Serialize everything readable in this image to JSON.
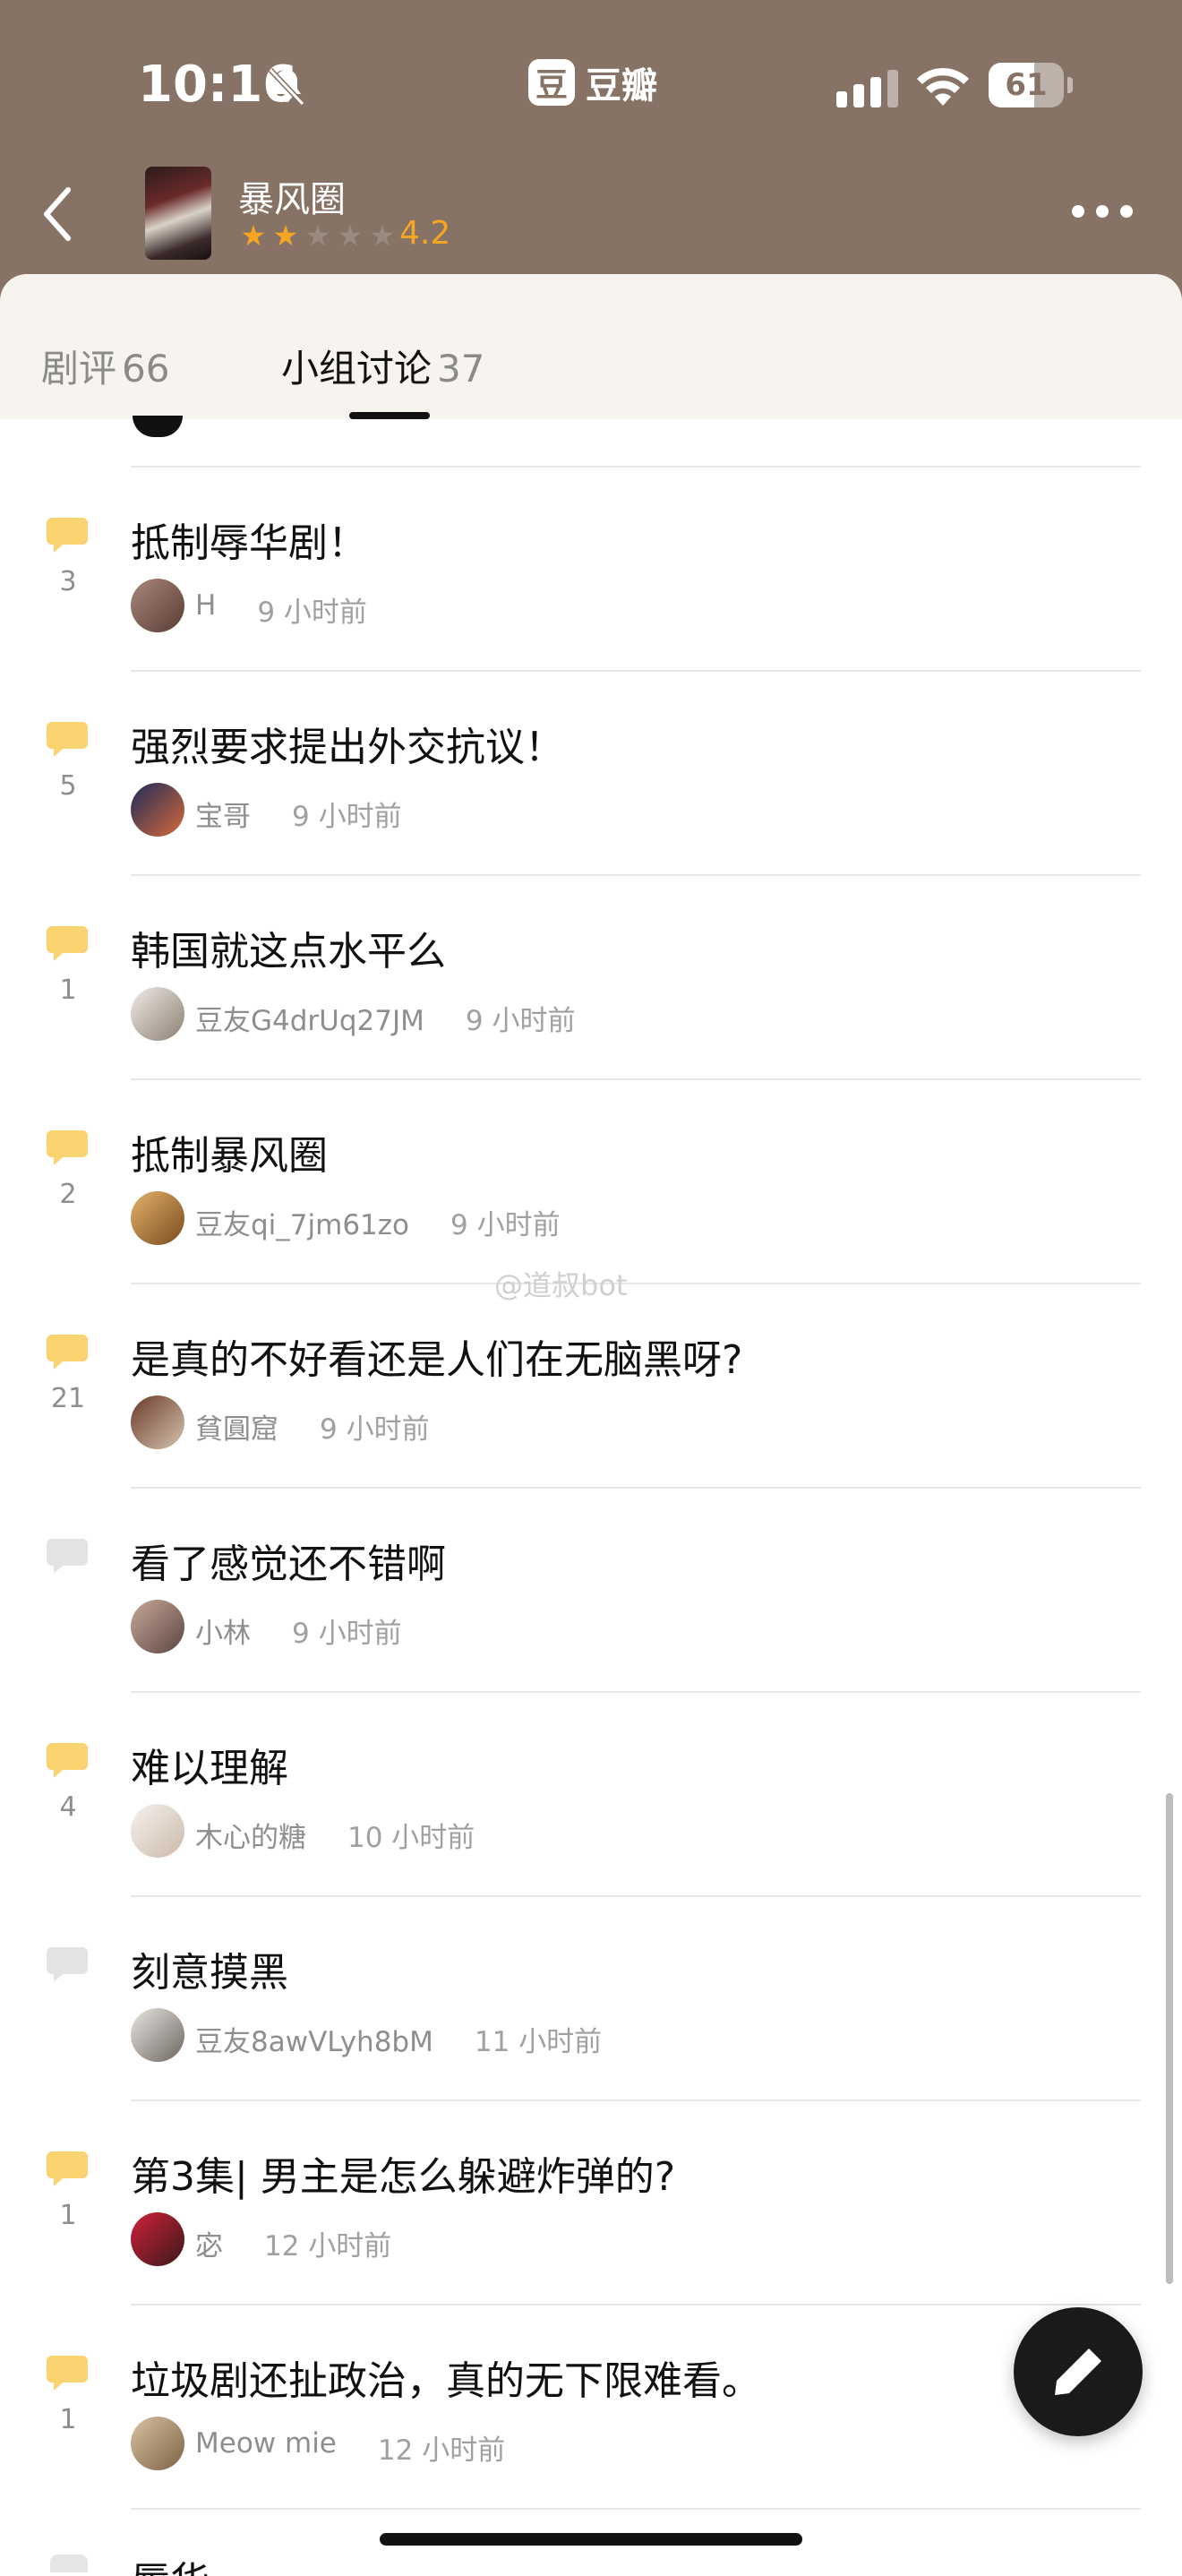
{
  "status_bar": {
    "time": "10:16",
    "battery": "61",
    "battery_level": 0.61
  },
  "app": {
    "name": "豆瓣",
    "logo_char": "豆"
  },
  "show": {
    "title": "暴风圈",
    "rating": "4.2",
    "stars_filled": 2,
    "stars_total": 5
  },
  "tabs": [
    {
      "label": "剧评",
      "count": "66",
      "active": false
    },
    {
      "label": "小组讨论",
      "count": "37",
      "active": true
    }
  ],
  "colors": {
    "header_bg": "#877365",
    "accent": "#f6a623",
    "bubble_active": "#f9d36f",
    "bubble_inactive": "#e3e3e3"
  },
  "items": [
    {
      "title": "抵制辱华剧！",
      "count": "3",
      "author": "H",
      "time": "9 小时前",
      "bubble": "active"
    },
    {
      "title": "强烈要求提出外交抗议！",
      "count": "5",
      "author": "宝哥",
      "time": "9 小时前",
      "bubble": "active"
    },
    {
      "title": "韩国就这点水平么",
      "count": "1",
      "author": "豆友G4drUq27JM",
      "time": "9 小时前",
      "bubble": "active"
    },
    {
      "title": "抵制暴风圈",
      "count": "2",
      "author": "豆友qi_7jm61zo",
      "time": "9 小时前",
      "bubble": "active"
    },
    {
      "title": "是真的不好看还是人们在无脑黑呀?",
      "count": "21",
      "author": "貧圓窟",
      "time": "9 小时前",
      "bubble": "active"
    },
    {
      "title": "看了感觉还不错啊",
      "count": "",
      "author": "小林",
      "time": "9 小时前",
      "bubble": "inactive"
    },
    {
      "title": "难以理解",
      "count": "4",
      "author": "木心的糖",
      "time": "10 小时前",
      "bubble": "active"
    },
    {
      "title": "刻意摸黑",
      "count": "",
      "author": "豆友8awVLyh8bM",
      "time": "11 小时前",
      "bubble": "inactive"
    },
    {
      "title": "第3集| 男主是怎么躲避炸弹的?",
      "count": "1",
      "author": "宓",
      "time": "12 小时前",
      "bubble": "active"
    },
    {
      "title": "垃圾剧还扯政治，真的无下限难看。",
      "count": "1",
      "author": "Meow mie",
      "time": "12 小时前",
      "bubble": "active"
    }
  ],
  "partial_next_title": "辱华剧",
  "watermark": "@道叔bot"
}
